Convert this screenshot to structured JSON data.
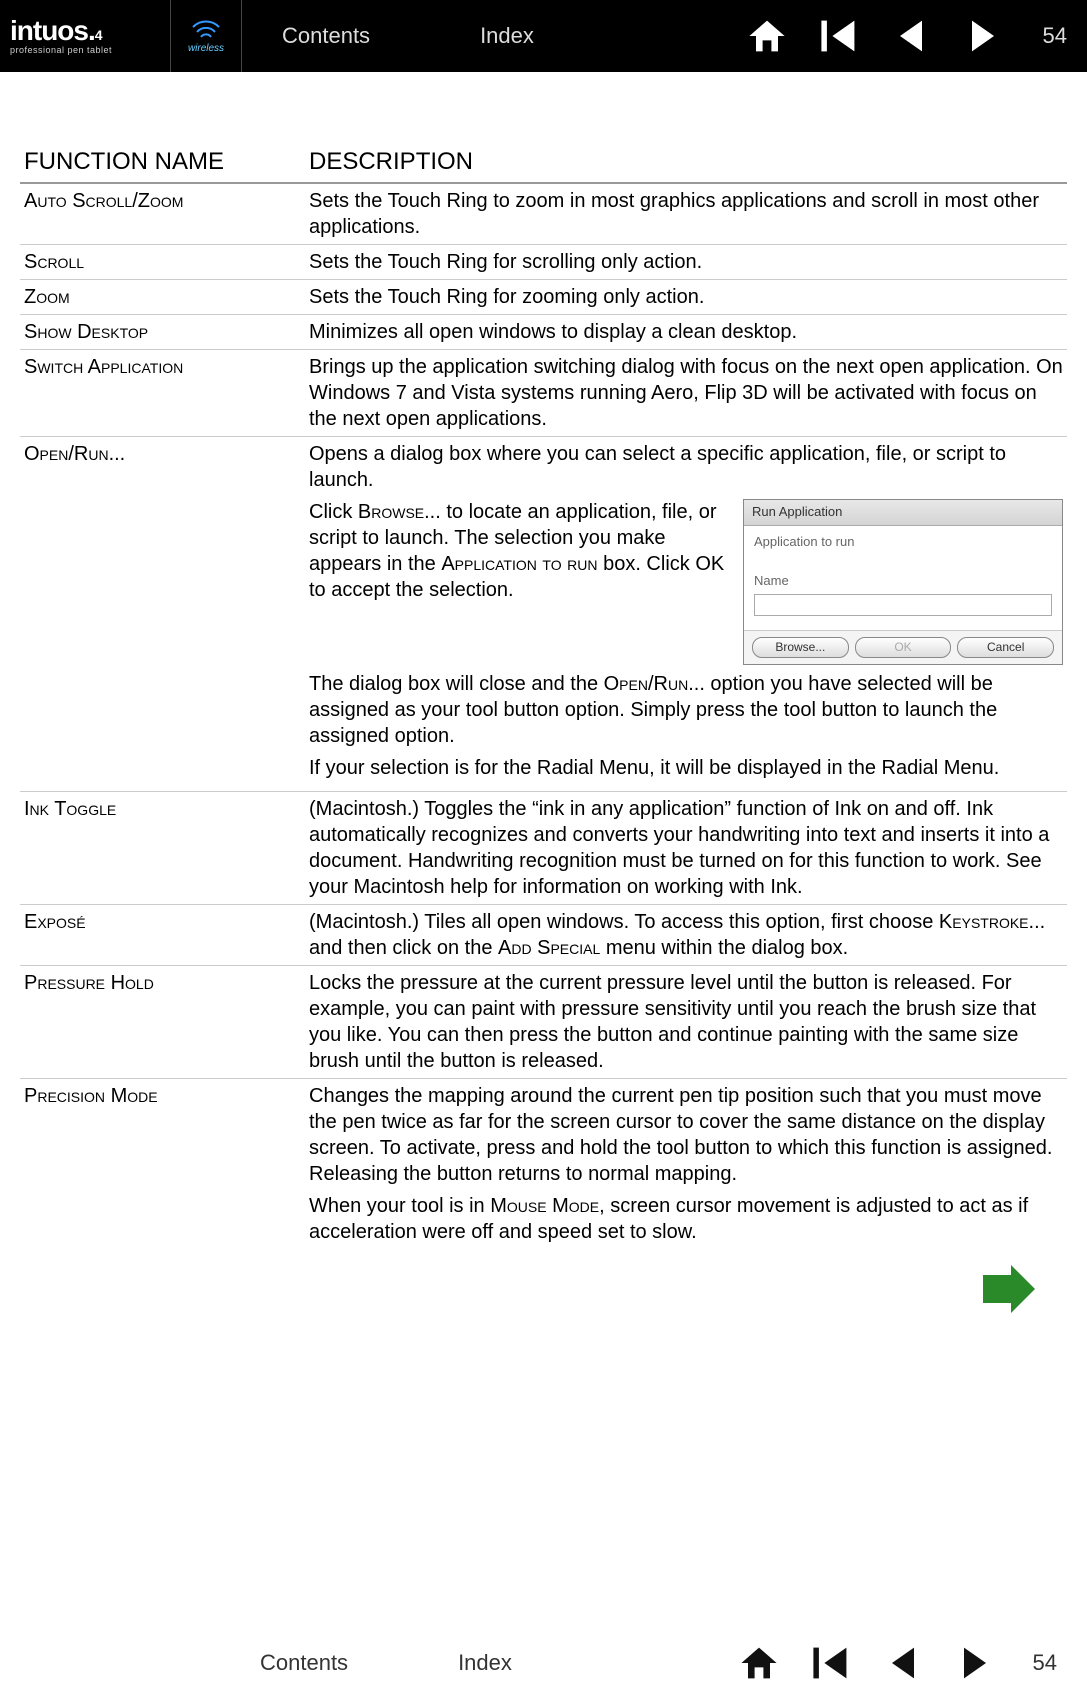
{
  "header": {
    "logo_text": "intuos.",
    "logo_suffix": "4",
    "logo_sub": "professional pen tablet",
    "wireless_label": "wireless",
    "contents": "Contents",
    "index": "Index",
    "page": "54"
  },
  "table": {
    "col1": "FUNCTION NAME",
    "col2": "DESCRIPTION"
  },
  "rows": {
    "autoscroll": {
      "name": "Auto Scroll/Zoom",
      "desc": "Sets the Touch Ring to zoom in most graphics applications and scroll in most other applications."
    },
    "scroll": {
      "name": "Scroll",
      "desc": "Sets the Touch Ring for scrolling only action."
    },
    "zoom": {
      "name": "Zoom",
      "desc": "Sets the Touch Ring for zooming only action."
    },
    "showdesk": {
      "name": "Show Desktop",
      "desc": "Minimizes all open windows to display a clean desktop."
    },
    "switchapp": {
      "name": "Switch Application",
      "desc": "Brings up the application switching dialog with focus on the next open application.  On Windows 7 and Vista systems running Aero, Flip 3D will be activated with focus on the next open applications."
    },
    "openrun": {
      "name": "Open/Run...",
      "p1": "Opens a dialog box where you can select a specific application, file, or script to launch.",
      "p2a": "Click ",
      "p2b": "Browse",
      "p2c": "... to locate an application, file, or script  to launch.  The selection you make appears in the ",
      "p2d": "Application to run",
      "p2e": " box.  Click OK to accept the selection.",
      "p3a": "The dialog box will close and the ",
      "p3b": "Open/Run",
      "p3c": "... option you have selected will be assigned as your tool button option.  Simply press the tool button to launch the assigned option.",
      "p4": "If your selection is for the Radial Menu, it will be displayed in the Radial Menu."
    },
    "inktoggle": {
      "name": "Ink Toggle",
      "desc": "(Macintosh.)  Toggles the “ink in any application” function of Ink on and off.  Ink automatically recognizes and converts your handwriting into text and inserts it into a document.  Handwriting recognition must be turned on for this function to work.  See your Macintosh help for information on working with Ink."
    },
    "expose": {
      "name": "Exposé",
      "a": "(Macintosh.)  Tiles all open windows.  To access this option, first choose ",
      "b": "Keystroke",
      "c": "... and then click on the ",
      "d": "Add Special",
      "e": " menu within the dialog box."
    },
    "pressurehold": {
      "name": "Pressure Hold",
      "desc": "Locks the pressure at the current pressure level until the button is released.  For example, you can paint with pressure sensitivity until you reach the brush size that you like.  You can then press the button and continue painting with the same size brush until the button is released."
    },
    "precision": {
      "name": "Precision Mode",
      "p1": "Changes the mapping around the current pen tip position such that you must move the pen twice as far for the screen cursor to cover the same distance on the display screen.  To activate, press and hold the tool button to which this function is assigned.  Releasing the button returns to normal mapping.",
      "p2a": "When your tool is in ",
      "p2b": "Mouse Mode",
      "p2c": ", screen cursor movement is adjusted to act as if acceleration were off and speed set to slow."
    }
  },
  "dialog": {
    "title": "Run Application",
    "lbl1": "Application to run",
    "lbl2": "Name",
    "browse": "Browse...",
    "ok": "OK",
    "cancel": "Cancel"
  },
  "footer": {
    "contents": "Contents",
    "index": "Index",
    "page": "54"
  }
}
